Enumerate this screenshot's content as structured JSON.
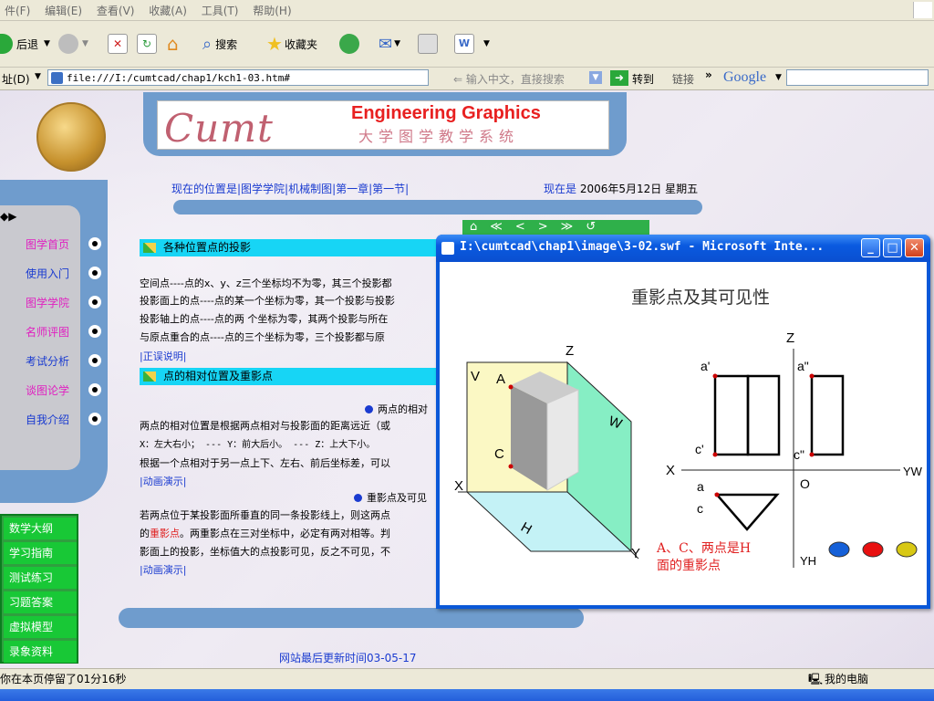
{
  "menu": {
    "items": [
      "件(F)",
      "编辑(E)",
      "查看(V)",
      "收藏(A)",
      "工具(T)",
      "帮助(H)"
    ]
  },
  "toolbar": {
    "back": "后退",
    "search": "搜索",
    "favorites": "收藏夹"
  },
  "addressbar": {
    "label": "址(D)",
    "url": "file:///I:/cumtcad/chap1/kch1-03.htm#",
    "search_hint": "输入中文，直接搜索",
    "go": "转到",
    "links": "链接",
    "google": "Google"
  },
  "header": {
    "logo_word": "Cumt",
    "english": "Engineering Graphics",
    "chinese": "大学图学教学系统"
  },
  "location": {
    "text": "现在的位置是|图学学院|机械制图|第一章|第一节|",
    "date_label": "现在是",
    "date": "2006年5月12日 星期五"
  },
  "nav": {
    "items": [
      "图学首页",
      "使用入门",
      "图学学院",
      "名师评图",
      "考试分析",
      "谈图论学",
      "自我介绍"
    ],
    "colors": [
      "#e020c0",
      "#1a3bd0",
      "#e020c0",
      "#e020c0",
      "#1a3bd0",
      "#e020c0",
      "#1a3bd0"
    ]
  },
  "pager": {
    "arrows": "⌂≪<>≫↺"
  },
  "content": {
    "section1": "各种位置点的投影",
    "p1": "空间点----点的x、y、z三个坐标均不为零，其三个投影都",
    "p2": "投影面上的点----点的某一个坐标为零，其一个投影与投影",
    "p3": "投影轴上的点----点的两 个坐标为零，其两个投影与所在",
    "p4": "与原点重合的点----点的三个坐标为零，三个投影都与原",
    "link1": "|正误说明|",
    "section2": "点的相对位置及重影点",
    "sub1": "两点的相对",
    "p5": "两点的相对位置是根据两点相对与投影面的距离远近（或",
    "p6": "X：左大右小；  --- Y：前大后小。  --- Z：上大下小。",
    "p7": "根据一个点相对于另一点上下、左右、前后坐标差，可以",
    "link2": "|动画演示|",
    "sub2": "重影点及可见",
    "p8": "若两点位于某投影面所垂直的同一条投影线上，则这两点",
    "p9a": "的",
    "p9b": "重影点",
    "p9c": "。两重影点在三对坐标中，必定有两对相等。判",
    "p10": "影面上的投影，坐标值大的点投影可见，反之不可见，不",
    "link3": "|动画演示|"
  },
  "green_menu": {
    "items": [
      "数学大纲",
      "学习指南",
      "测试练习",
      "习题答案",
      "虚拟模型",
      "录象资料"
    ]
  },
  "footer": {
    "update": "网站最后更新时间03-05-17"
  },
  "status": {
    "text": "你在本页停留了01分16秒",
    "computer": "我的电脑"
  },
  "popup": {
    "title": "I:\\cumtcad\\chap1\\image\\3-02.swf - Microsoft Inte...",
    "heading": "重影点及其可见性",
    "labels": {
      "Z": "Z",
      "V": "V",
      "A": "A",
      "C": "C",
      "W": "W",
      "X": "X",
      "H": "H",
      "Y": "Y",
      "Z2": "Z",
      "a_prime": "a'",
      "a_dprime": "a\"",
      "c_prime": "c'",
      "c_dprime": "c\"",
      "X2": "X",
      "O": "O",
      "Yw": "YW",
      "a": "a",
      "c": "c",
      "Yh": "YH"
    },
    "note1": "A、C、两点是H",
    "note2": "面的重影点",
    "dot_colors": [
      "#1560d8",
      "#e81010",
      "#d8c814"
    ]
  }
}
